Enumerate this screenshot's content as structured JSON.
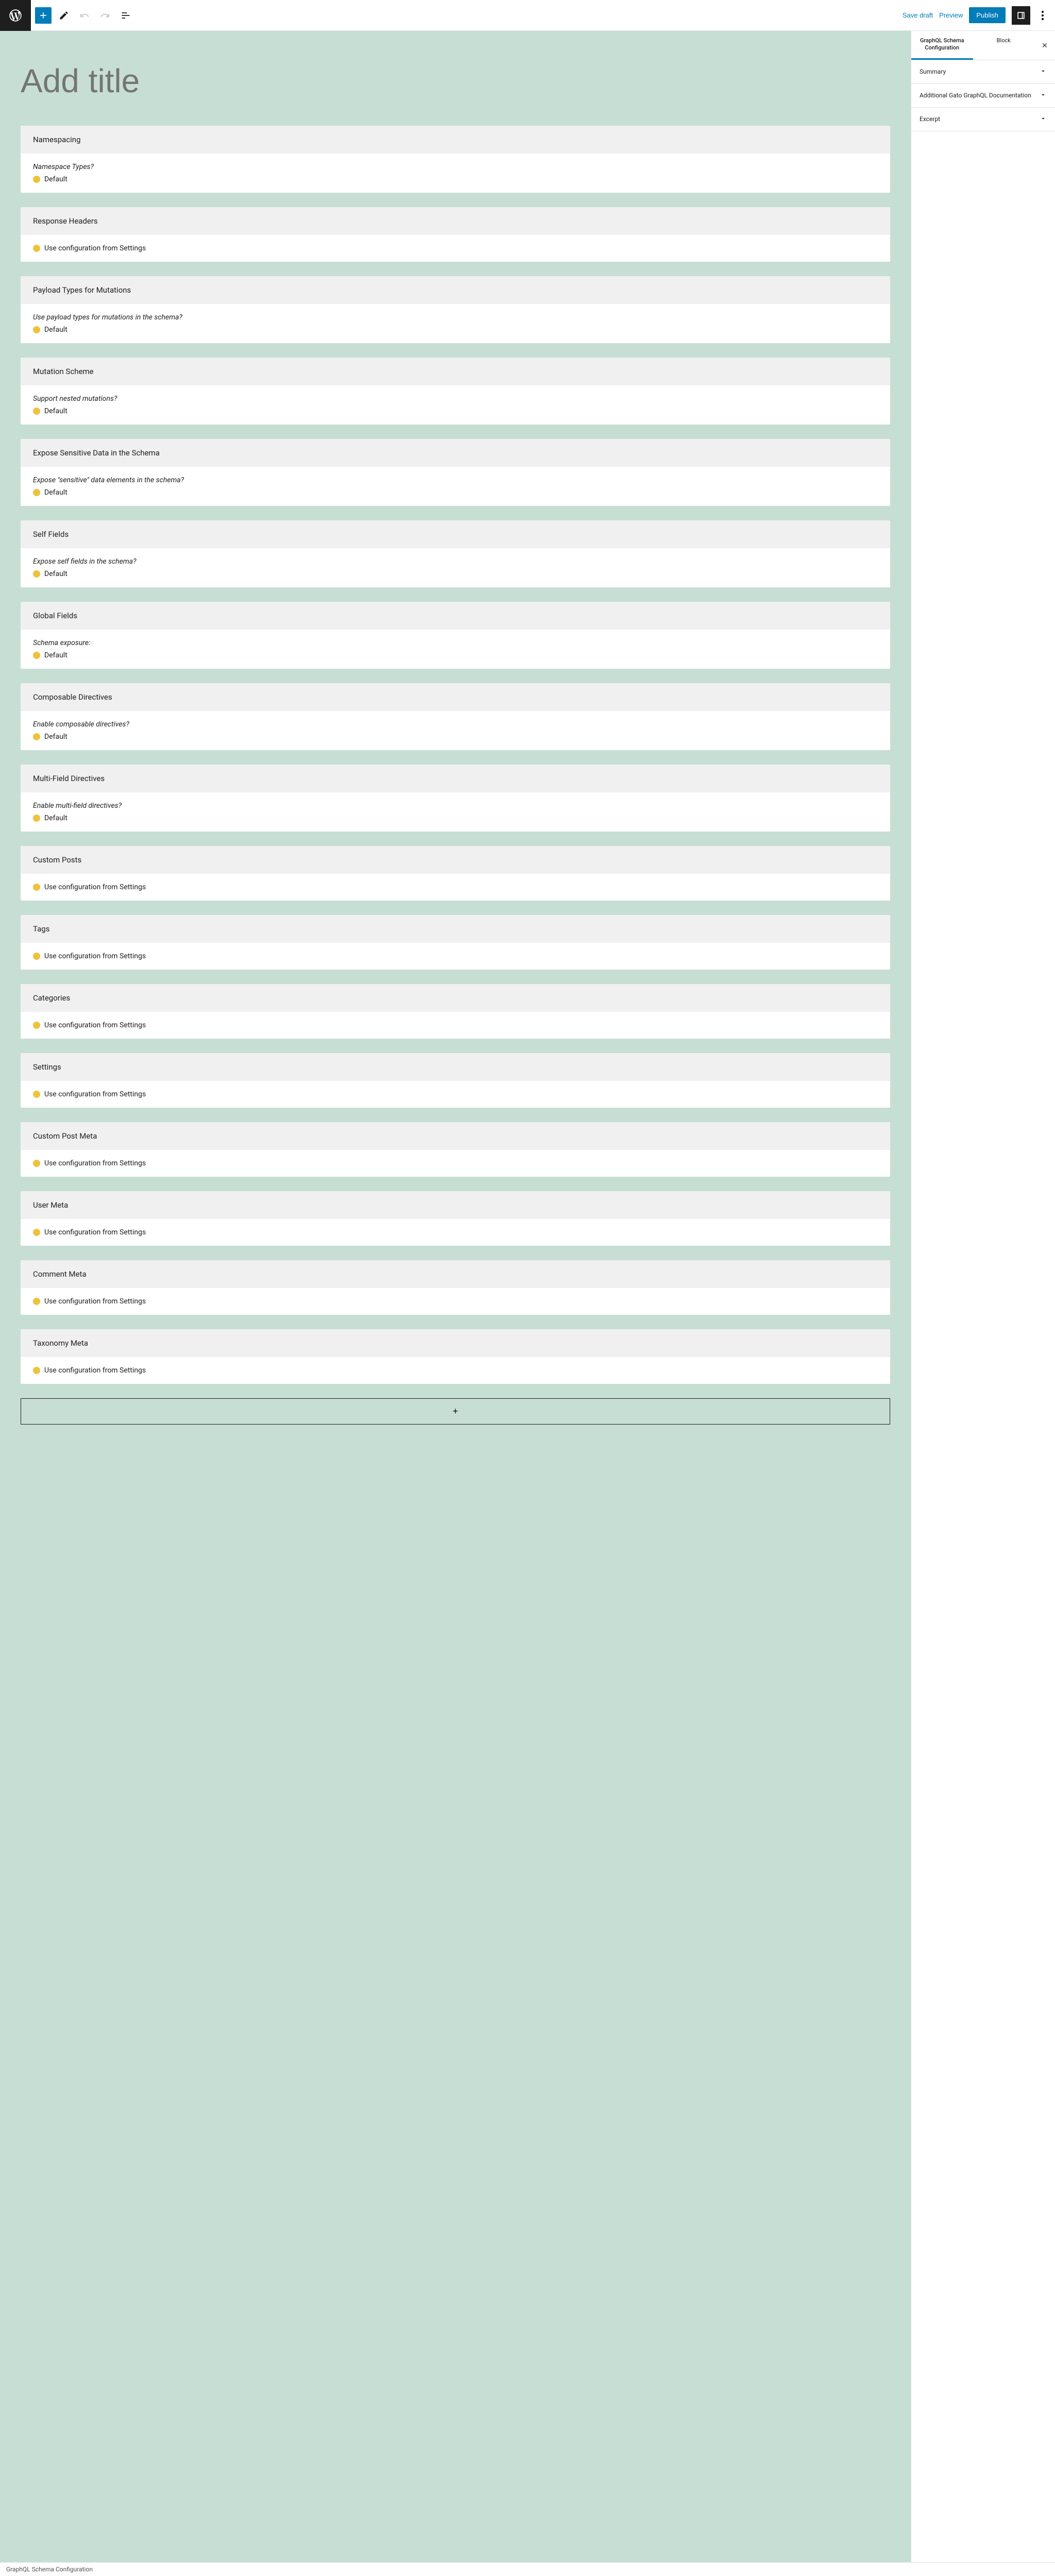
{
  "topbar": {
    "save_draft": "Save draft",
    "preview": "Preview",
    "publish": "Publish"
  },
  "title_placeholder": "Add title",
  "blocks": [
    {
      "header": "Namespacing",
      "question": "Namespace Types?",
      "value": "Default"
    },
    {
      "header": "Response Headers",
      "question": "",
      "value": "Use configuration from Settings"
    },
    {
      "header": "Payload Types for Mutations",
      "question": "Use payload types for mutations in the schema?",
      "value": "Default"
    },
    {
      "header": "Mutation Scheme",
      "question": "Support nested mutations?",
      "value": "Default"
    },
    {
      "header": "Expose Sensitive Data in the Schema",
      "question": "Expose \"sensitive\" data elements in the schema?",
      "value": "Default"
    },
    {
      "header": "Self Fields",
      "question": "Expose self fields in the schema?",
      "value": "Default"
    },
    {
      "header": "Global Fields",
      "question": "Schema exposure:",
      "value": "Default"
    },
    {
      "header": "Composable Directives",
      "question": "Enable composable directives?",
      "value": "Default"
    },
    {
      "header": "Multi-Field Directives",
      "question": "Enable multi-field directives?",
      "value": "Default"
    },
    {
      "header": "Custom Posts",
      "question": "",
      "value": "Use configuration from Settings"
    },
    {
      "header": "Tags",
      "question": "",
      "value": "Use configuration from Settings"
    },
    {
      "header": "Categories",
      "question": "",
      "value": "Use configuration from Settings"
    },
    {
      "header": "Settings",
      "question": "",
      "value": "Use configuration from Settings"
    },
    {
      "header": "Custom Post Meta",
      "question": "",
      "value": "Use configuration from Settings"
    },
    {
      "header": "User Meta",
      "question": "",
      "value": "Use configuration from Settings"
    },
    {
      "header": "Comment Meta",
      "question": "",
      "value": "Use configuration from Settings"
    },
    {
      "header": "Taxonomy Meta",
      "question": "",
      "value": "Use configuration from Settings"
    }
  ],
  "add_block_label": "+",
  "sidebar": {
    "tab1": "GraphQL Schema Configuration",
    "tab2": "Block",
    "panels": [
      {
        "label": "Summary"
      },
      {
        "label": "Additional Gato GraphQL Documentation"
      },
      {
        "label": "Excerpt"
      }
    ]
  },
  "footer": "GraphQL Schema Configuration"
}
